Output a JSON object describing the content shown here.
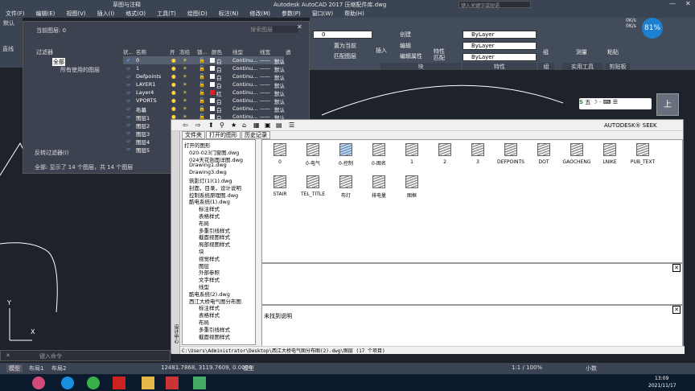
{
  "titlebar": {
    "workspace": "草图与注释",
    "title": "Autodesk AutoCAD 2017    压缩配件库.dwg",
    "search_placeholder": "键入关键字或短语"
  },
  "menu": [
    "文件(F)",
    "编辑(E)",
    "视图(V)",
    "插入(I)",
    "格式(O)",
    "工具(T)",
    "绘图(D)",
    "标注(N)",
    "修改(M)",
    "参数(P)",
    "窗口(W)",
    "帮助(H)"
  ],
  "ribbon": {
    "layer_combo": "0",
    "buttons": [
      "置为当前",
      "匹配图层",
      "创建",
      "编辑",
      "编辑属性",
      "插入",
      "特性匹配",
      "组",
      "测量",
      "粘贴"
    ],
    "bylayer1": "ByLayer",
    "bylayer2": "ByLayer",
    "bylayer3": "ByLayer",
    "panels": [
      "块",
      "特性",
      "组",
      "实用工具",
      "剪贴板"
    ]
  },
  "netspeed": {
    "up": "0K/s",
    "down": "0K/s",
    "pct": "81"
  },
  "left": {
    "a": "默认",
    "b": "直线"
  },
  "layerpal": {
    "current": "当前图层: 0",
    "search": "搜索图层",
    "filters_title": "过滤器",
    "all": "全部",
    "used": "所有使用的图层",
    "invert": "反转过滤器(I)",
    "summary": "全部: 显示了 14 个图层，共 14 个图层",
    "headers": [
      "状...",
      "名称",
      "开",
      "冻结",
      "锁...",
      "颜色",
      "线型",
      "线宽",
      "透"
    ],
    "rows": [
      {
        "name": "0",
        "color": "白",
        "lt": "Continu...",
        "lw": "默认"
      },
      {
        "name": "1",
        "color": "白",
        "lt": "Continu...",
        "lw": "默认"
      },
      {
        "name": "Defpoints",
        "color": "白",
        "lt": "Continu...",
        "lw": "默认"
      },
      {
        "name": "LAYER1",
        "color": "白",
        "lt": "Continu...",
        "lw": "默认"
      },
      {
        "name": "Layer4",
        "color": "红",
        "lt": "Continu...",
        "lw": "默认"
      },
      {
        "name": "VPORTS",
        "color": "白",
        "lt": "Continu...",
        "lw": "默认"
      },
      {
        "name": "布幕",
        "color": "白",
        "lt": "Continu...",
        "lw": "默认"
      },
      {
        "name": "图层1",
        "color": "白",
        "lt": "Continu...",
        "lw": "默认"
      },
      {
        "name": "图层2",
        "color": "白",
        "lt": "Continu...",
        "lw": "默认"
      },
      {
        "name": "图层3",
        "color": "白",
        "lt": "Continu...",
        "lw": "默认"
      },
      {
        "name": "图层4",
        "color": "白",
        "lt": "Continu...",
        "lw": "默认"
      },
      {
        "name": "图层5",
        "color": "白",
        "lt": "Continu...",
        "lw": "默认"
      }
    ]
  },
  "dc": {
    "brand": "AUTODESK® SEEK",
    "tabs": [
      "文件夹",
      "打开的图形",
      "历史记录"
    ],
    "tree": [
      "打开的图形",
      "020-023门窗图.dwg",
      "024天花剖面详图.dwg",
      "Drawing1.dwg",
      "Drawing3.dwg",
      "筑影灯(1)(1).dwg",
      "封面，目录，设计说明",
      "控制系统原理图.dwg",
      "酷电系统(1).dwg",
      "标注样式",
      "表格样式",
      "布局",
      "多重引线样式",
      "截面视图样式",
      "局部视图样式",
      "块",
      "视觉样式",
      "图层",
      "外部参照",
      "文字样式",
      "线型",
      "酷电系统(2).dwg",
      "西江大桥电气图分布图",
      "标注样式",
      "表格样式",
      "布局",
      "多重引线样式",
      "截面视图样式"
    ],
    "items": [
      "0",
      "0-电气",
      "0-控制",
      "0-图名",
      "1",
      "2",
      "3",
      "DEFPOINTS",
      "DOT",
      "GAOCHENG",
      "LNIKE",
      "PUB_TEXT",
      "STAIR",
      "TEL_TITLE",
      "布灯",
      "排电量",
      "图框"
    ],
    "desc": "未找到说明",
    "path": "C:\\Users\\Administrator\\Desktop\\西江大桥电气图分布图(2).dwg\\图层 (17 个项目)",
    "side": "设计中心"
  },
  "cmd": {
    "placeholder": "键入命令"
  },
  "tabs": [
    "模型",
    "布局1",
    "布局2"
  ],
  "status": {
    "coords": "12481.7868, 3119.7609, 0.0000",
    "mode": "模型",
    "scale": "1:1 / 100%",
    "unit": "小数"
  },
  "taskbar": {
    "time": "13:09",
    "date": "2021/11/17"
  }
}
